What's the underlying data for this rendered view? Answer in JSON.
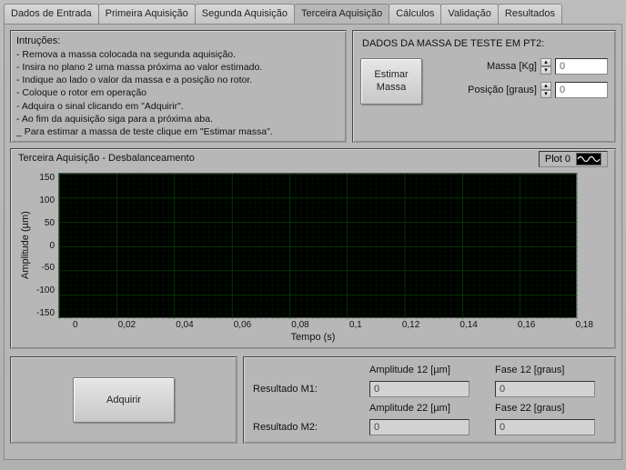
{
  "tabs": {
    "t0": "Dados de Entrada",
    "t1": "Primeira Aquisição",
    "t2": "Segunda Aquisição",
    "t3": "Terceira Aquisição",
    "t4": "Cálculos",
    "t5": "Validação",
    "t6": "Resultados"
  },
  "instructions": {
    "title": "Intruções:",
    "l0": "- Remova a massa colocada na segunda aquisição.",
    "l1": "- Insira no plano 2 uma massa próxima ao valor estimado.",
    "l2": "- Indique ao lado o valor da massa e a posição no rotor.",
    "l3": "- Coloque o rotor em operação",
    "l4": "- Adquira o sinal clicando em \"Adquirir\".",
    "l5": "- Ao fim da aquisição siga para a próxima aba.",
    "l6": "_ Para estimar a massa de teste clique em \"Estimar massa\"."
  },
  "massdata": {
    "title": "DADOS DA MASSA DE TESTE EM PT2:",
    "estimate_btn": "Estimar\nMassa",
    "mass_label": "Massa [Kg]",
    "mass_value": "0",
    "pos_label": "Posição [graus]",
    "pos_value": "0"
  },
  "chart": {
    "title": "Terceira Aquisição - Desbalanceamento",
    "legend": "Plot 0",
    "ylabel": "Amplitude (µm)",
    "xlabel": "Tempo (s)",
    "yticks": {
      "y0": "150",
      "y1": "100",
      "y2": "50",
      "y3": "0",
      "y4": "-50",
      "y5": "-100",
      "y6": "-150"
    },
    "xticks": {
      "x0": "0",
      "x1": "0,02",
      "x2": "0,04",
      "x3": "0,06",
      "x4": "0,08",
      "x5": "0,1",
      "x6": "0,12",
      "x7": "0,14",
      "x8": "0,16",
      "x9": "0,18"
    }
  },
  "acquire": {
    "btn": "Adquirir"
  },
  "results": {
    "amp12_label": "Amplitude 12 [µm]",
    "fase12_label": "Fase 12 [graus]",
    "m1_label": "Resultado M1:",
    "amp12_val": "0",
    "fase12_val": "0",
    "amp22_label": "Amplitude 22 [µm]",
    "fase22_label": "Fase 22 [graus]",
    "m2_label": "Resultado M2:",
    "amp22_val": "0",
    "fase22_val": "0"
  },
  "chart_data": {
    "type": "line",
    "title": "Terceira Aquisição - Desbalanceamento",
    "xlabel": "Tempo (s)",
    "ylabel": "Amplitude (µm)",
    "xlim": [
      0,
      0.18
    ],
    "ylim": [
      -150,
      150
    ],
    "series": [
      {
        "name": "Plot 0",
        "x": [],
        "y": []
      }
    ]
  }
}
